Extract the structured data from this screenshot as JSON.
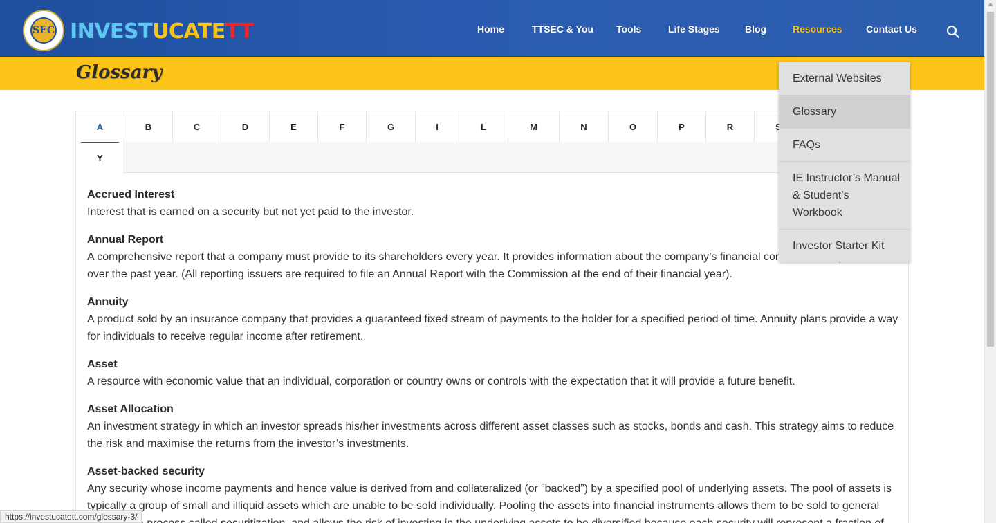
{
  "header": {
    "logo_seal_text": "SEC",
    "brand": {
      "part1": "INVEST",
      "part2": "UCATE",
      "part3": "TT"
    },
    "nav": [
      {
        "label": "Home",
        "active": false
      },
      {
        "label": "TTSEC & You",
        "active": false
      },
      {
        "label": "Tools",
        "active": false
      },
      {
        "label": "Life Stages",
        "active": false
      },
      {
        "label": "Blog",
        "active": false
      },
      {
        "label": "Resources",
        "active": true
      },
      {
        "label": "Contact Us",
        "active": false
      }
    ],
    "search_icon": "search-icon"
  },
  "page_title": "Glossary",
  "tabs": [
    "A",
    "B",
    "C",
    "D",
    "E",
    "F",
    "G",
    "I",
    "L",
    "M",
    "N",
    "O",
    "P",
    "R",
    "S",
    "Y"
  ],
  "active_tab": "A",
  "entries": [
    {
      "term": "Accrued Interest",
      "definition": "Interest that is earned on a security but not yet paid to the investor."
    },
    {
      "term": "Annual Report",
      "definition": "A comprehensive report that a company must provide to its shareholders every year. It provides information about the company’s financial condition and operations over the past year. (All reporting issuers are required to file an Annual Report with the Commission at the end of their financial year)."
    },
    {
      "term": "Annuity",
      "definition": "A product sold by an insurance company that provides a guaranteed fixed stream of payments to the holder for a specified period of time. Annuity plans provide a way for individuals to receive regular income after retirement."
    },
    {
      "term": "Asset",
      "definition": "A resource with economic value that an individual, corporation or country owns or controls with the expectation that it will provide a future benefit."
    },
    {
      "term": "Asset Allocation",
      "definition": "An investment strategy in which an investor spreads his/her investments across different asset classes such as stocks, bonds and cash. This strategy aims to reduce the risk and maximise the returns from the investor’s investments."
    },
    {
      "term": "Asset-backed security",
      "definition": "Any security whose income payments and hence value is derived from and collateralized (or “backed”) by a specified pool of underlying assets. The pool of assets is typically a group of small and illiquid assets which are unable to be sold individually. Pooling the assets into financial instruments allows them to be sold to general investors, a process called securitization, and allows the risk of investing in the underlying assets to be diversified because each security will represent a fraction of"
    }
  ],
  "dropdown": [
    {
      "label": "External Websites",
      "active": false
    },
    {
      "label": "Glossary",
      "active": true
    },
    {
      "label": "FAQs",
      "active": false
    },
    {
      "label": "IE Instructor’s Manual & Student’s Workbook",
      "active": false
    },
    {
      "label": "Investor Starter Kit",
      "active": false
    }
  ],
  "status_url": "https://investucatett.com/glossary-3/",
  "colors": {
    "header_blue": "#2a5bb0",
    "title_yellow": "#fcc419",
    "active_nav": "#f5c319",
    "active_tab": "#1e5fa8"
  }
}
